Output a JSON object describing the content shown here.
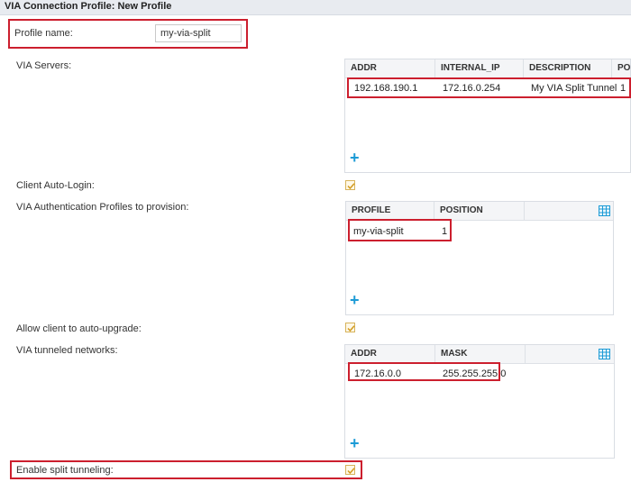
{
  "window": {
    "title": "VIA Connection Profile: New Profile"
  },
  "profile_name": {
    "label": "Profile name:",
    "value": "my-via-split"
  },
  "via_servers": {
    "label": "VIA Servers:",
    "columns": [
      "ADDR",
      "INTERNAL_IP",
      "DESCRIPTION",
      "POS"
    ],
    "rows": [
      {
        "addr": "192.168.190.1",
        "internal_ip": "172.16.0.254",
        "description": "My VIA Split Tunnel",
        "pos": "1"
      }
    ]
  },
  "client_auto_login": {
    "label": "Client Auto-Login:",
    "checked": true
  },
  "auth_profiles": {
    "label": "VIA Authentication Profiles to provision:",
    "columns": [
      "PROFILE",
      "POSITION"
    ],
    "rows": [
      {
        "profile": "my-via-split",
        "position": "1"
      }
    ]
  },
  "auto_upgrade": {
    "label": "Allow client to auto-upgrade:",
    "checked": true
  },
  "tunneled_networks": {
    "label": "VIA tunneled networks:",
    "columns": [
      "ADDR",
      "MASK"
    ],
    "rows": [
      {
        "addr": "172.16.0.0",
        "mask": "255.255.255.0"
      }
    ]
  },
  "split_tunneling": {
    "label": "Enable split tunneling:",
    "checked": true
  },
  "colors": {
    "highlight": "#cc1f2e",
    "add_icon": "#1c9bd6",
    "checkbox_border": "#d7b35b"
  },
  "icons": {
    "add": "plus-icon",
    "columns": "table-columns-icon",
    "check": "checkmark-icon"
  }
}
